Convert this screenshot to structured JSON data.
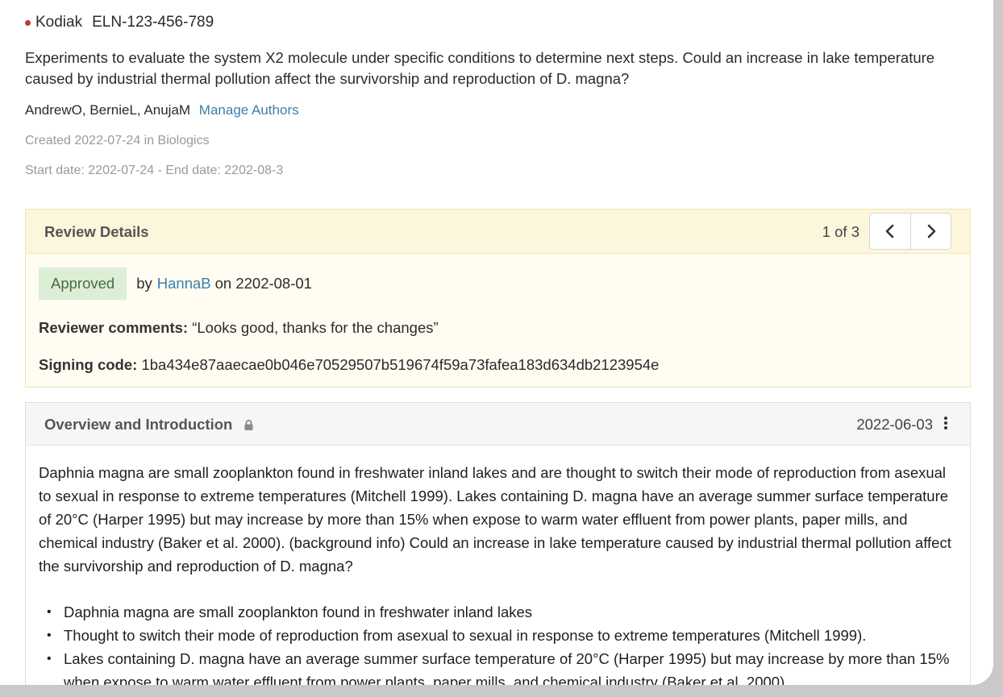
{
  "experiment": {
    "project": "Kodiak",
    "id": "ELN-123-456-789",
    "description": "Experiments to evaluate the system X2 molecule under specific conditions to determine next steps. Could an increase in lake temperature caused by industrial thermal pollution affect the survivorship and reproduction of D. magna?",
    "authors": "AndrewO, BernieL, AnujaM",
    "manage_authors_label": "Manage Authors",
    "created": "Created 2022-07-24 in Biologics",
    "dates": "Start date: 2202-07-24  - End date: 2202-08-3"
  },
  "review": {
    "title": "Review Details",
    "pager": "1 of 3",
    "status": "Approved",
    "by_label": "by",
    "reviewer": "HannaB",
    "on_date": "on 2202-08-01",
    "comments_label": "Reviewer comments:",
    "comments": "“Looks good, thanks for the changes”",
    "signing_label": "Signing code:",
    "signing_code": "1ba434e87aaecae0b046e70529507b519674f59a73fafea183d634db2123954e"
  },
  "section": {
    "title": "Overview and Introduction",
    "date": "2022-06-03",
    "paragraph": "Daphnia magna are small zooplankton found in freshwater inland lakes and are thought to switch their mode of reproduction from asexual to sexual in response to extreme temperatures (Mitchell 1999). Lakes containing D. magna have an average summer surface temperature of 20°C (Harper 1995) but may increase by more than 15% when expose to warm water effluent from power plants, paper mills, and chemical industry (Baker et al. 2000). (background info) Could an increase in lake temperature caused by industrial thermal pollution affect the survivorship and reproduction of D. magna?",
    "bullets": [
      "Daphnia magna are small zooplankton found in freshwater inland lakes",
      "Thought to switch their mode of reproduction from asexual to sexual in response to extreme temperatures (Mitchell 1999).",
      "Lakes containing D. magna have an average summer surface temperature of 20°C (Harper 1995) but may increase by more than 15% when expose to warm water effluent from power plants, paper mills, and chemical industry (Baker et al. 2000)."
    ]
  },
  "icons": {
    "status_dot": "status-dot-icon",
    "prev": "chevron-left-icon",
    "next": "chevron-right-icon",
    "lock": "lock-icon",
    "menu": "kebab-menu-icon"
  },
  "colors": {
    "link": "#3a7fae",
    "status_dot": "#c0392b",
    "approved_bg": "#dcefd6",
    "review_header_bg": "#fbf6dc"
  }
}
